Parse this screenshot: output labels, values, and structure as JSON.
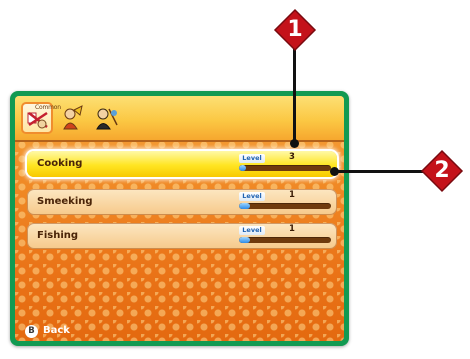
{
  "menu": {
    "tabs": [
      {
        "name": "skills-tab",
        "label": "Common",
        "active": true
      },
      {
        "name": "profession-tab-2",
        "label": "",
        "active": false
      },
      {
        "name": "profession-tab-3",
        "label": "",
        "active": false
      }
    ],
    "skills": [
      {
        "name": "Cooking",
        "level_label": "Level",
        "level": "3",
        "exp_fraction": 0.08,
        "selected": true
      },
      {
        "name": "Smeeking",
        "level_label": "Level",
        "level": "1",
        "exp_fraction": 0.12,
        "selected": false
      },
      {
        "name": "Fishing",
        "level_label": "Level",
        "level": "1",
        "exp_fraction": 0.12,
        "selected": false
      }
    ],
    "back": {
      "button_glyph": "B",
      "label": "Back"
    }
  },
  "callouts": [
    {
      "number": "1"
    },
    {
      "number": "2"
    }
  ],
  "colors": {
    "frame": "#129a52",
    "callout_red": "#c4121a",
    "selected_row": "#ffe522"
  }
}
